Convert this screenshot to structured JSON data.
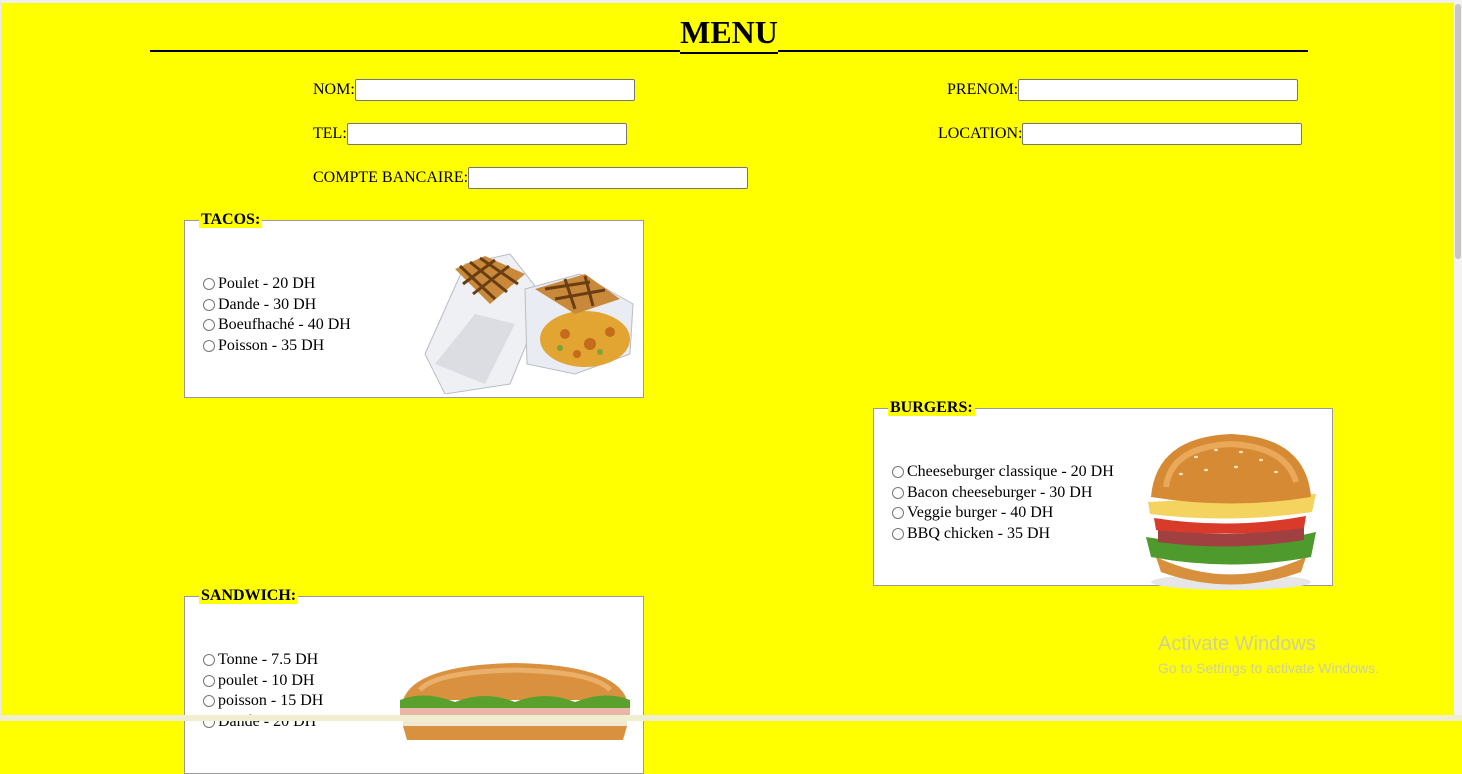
{
  "page": {
    "title": "MENU",
    "background_color": "#ffff00"
  },
  "form": {
    "nom_label": "NOM:",
    "nom_value": "",
    "prenom_label": "PRENOM:",
    "prenom_value": "",
    "tel_label": "TEL:",
    "tel_value": "",
    "location_label": "LOCATION:",
    "location_value": "",
    "compte_label": "COMPTE BANCAIRE:",
    "compte_value": ""
  },
  "sections": {
    "tacos": {
      "legend": "TACOS:",
      "options": [
        "Poulet - 20 DH",
        "Dande - 30 DH",
        "Boeufhaché - 40 DH",
        "Poisson - 35 DH"
      ],
      "image_icon": "tacos-image"
    },
    "burgers": {
      "legend": "BURGERS:",
      "options": [
        "Cheeseburger classique - 20 DH",
        "Bacon cheeseburger - 30 DH",
        "Veggie burger - 40 DH",
        "BBQ chicken - 35 DH"
      ],
      "image_icon": "burger-image"
    },
    "sandwich": {
      "legend": "SANDWICH:",
      "options": [
        "Tonne - 7.5 DH",
        "poulet - 10 DH",
        "poisson - 15 DH",
        "Dande - 20 DH"
      ],
      "image_icon": "sandwich-image"
    }
  },
  "watermark": {
    "line1": "Activate Windows",
    "line2": "Go to Settings to activate Windows."
  }
}
